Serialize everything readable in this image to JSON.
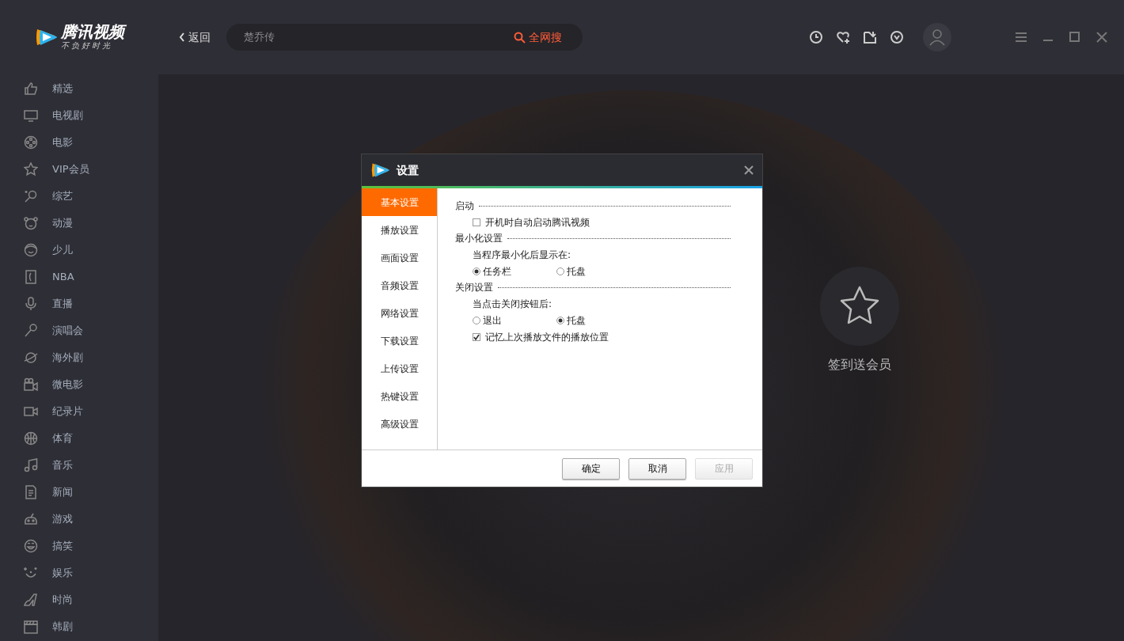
{
  "app": {
    "logo_text": "腾讯视频",
    "slogan": "不负好时光"
  },
  "top_bar": {
    "back": "返回",
    "search": {
      "placeholder": "楚乔传"
    },
    "search_button": "全网搜"
  },
  "sidebar": {
    "items": [
      {
        "label": "精选"
      },
      {
        "label": "电视剧"
      },
      {
        "label": "电影"
      },
      {
        "label": "VIP会员"
      },
      {
        "label": "综艺"
      },
      {
        "label": "动漫"
      },
      {
        "label": "少儿"
      },
      {
        "label": "NBA"
      },
      {
        "label": "直播"
      },
      {
        "label": "演唱会"
      },
      {
        "label": "海外剧"
      },
      {
        "label": "微电影"
      },
      {
        "label": "纪录片"
      },
      {
        "label": "体育"
      },
      {
        "label": "音乐"
      },
      {
        "label": "新闻"
      },
      {
        "label": "游戏"
      },
      {
        "label": "搞笑"
      },
      {
        "label": "娱乐"
      },
      {
        "label": "时尚"
      },
      {
        "label": "韩剧"
      }
    ]
  },
  "promo": {
    "label": "签到送会员"
  },
  "dialog": {
    "title": "设置",
    "nav": [
      {
        "label": "基本设置",
        "selected": true
      },
      {
        "label": "播放设置",
        "selected": false
      },
      {
        "label": "画面设置",
        "selected": false
      },
      {
        "label": "音频设置",
        "selected": false
      },
      {
        "label": "网络设置",
        "selected": false
      },
      {
        "label": "下载设置",
        "selected": false
      },
      {
        "label": "上传设置",
        "selected": false
      },
      {
        "label": "热键设置",
        "selected": false
      },
      {
        "label": "高级设置",
        "selected": false
      }
    ],
    "sections": [
      {
        "title": "启动",
        "items": [
          {
            "kind": "checkbox",
            "label": "开机时自动启动腾讯视频",
            "checked": false
          }
        ]
      },
      {
        "title": "最小化设置",
        "items": [
          {
            "kind": "text",
            "label": "当程序最小化后显示在:"
          },
          {
            "kind": "radios",
            "options": [
              {
                "label": "任务栏",
                "selected": true
              },
              {
                "label": "托盘",
                "selected": false
              }
            ]
          }
        ]
      },
      {
        "title": "关闭设置",
        "items": [
          {
            "kind": "text",
            "label": "当点击关闭按钮后:"
          },
          {
            "kind": "radios",
            "options": [
              {
                "label": "退出",
                "selected": false
              },
              {
                "label": "托盘",
                "selected": true
              }
            ]
          },
          {
            "kind": "checkbox",
            "label": "记忆上次播放文件的播放位置",
            "checked": true
          }
        ]
      }
    ],
    "buttons": [
      {
        "label": "确定",
        "disabled": false
      },
      {
        "label": "取消",
        "disabled": false
      },
      {
        "label": "应用",
        "disabled": true
      }
    ]
  }
}
